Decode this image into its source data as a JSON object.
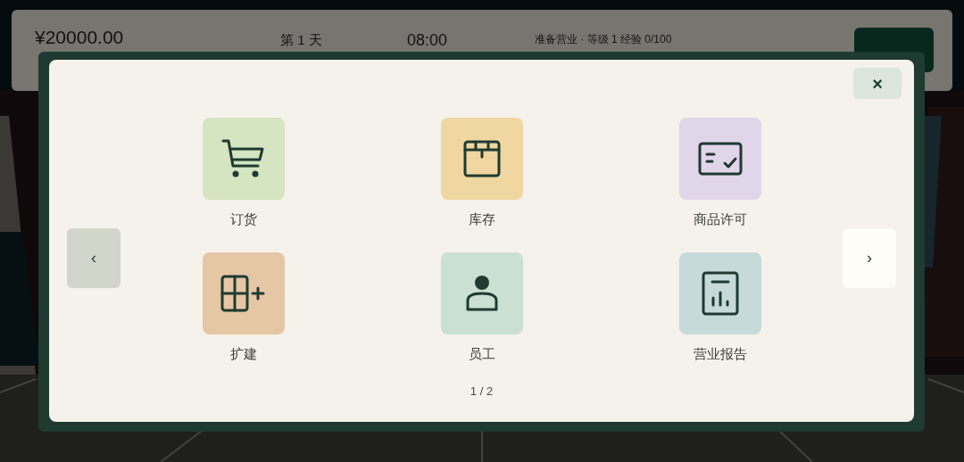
{
  "hud": {
    "balance": "¥20000.00",
    "day": "第 1 天",
    "time": "08:00",
    "status": "准备营业 · 等级 1  经验 0/100"
  },
  "panel": {
    "close": "×",
    "prev": "‹",
    "next": "›",
    "page": "1 / 2",
    "items": [
      {
        "kind": "cart",
        "label": "订货",
        "color": "#d5e4c1"
      },
      {
        "kind": "box",
        "label": "库存",
        "color": "#f0d6a0"
      },
      {
        "kind": "license",
        "label": "商品许可",
        "color": "#e1d5ea"
      },
      {
        "kind": "expand",
        "label": "扩建",
        "color": "#e5c6a5"
      },
      {
        "kind": "staff",
        "label": "员工",
        "color": "#c9e0d3"
      },
      {
        "kind": "report",
        "label": "营业报告",
        "color": "#c7dada"
      }
    ]
  }
}
